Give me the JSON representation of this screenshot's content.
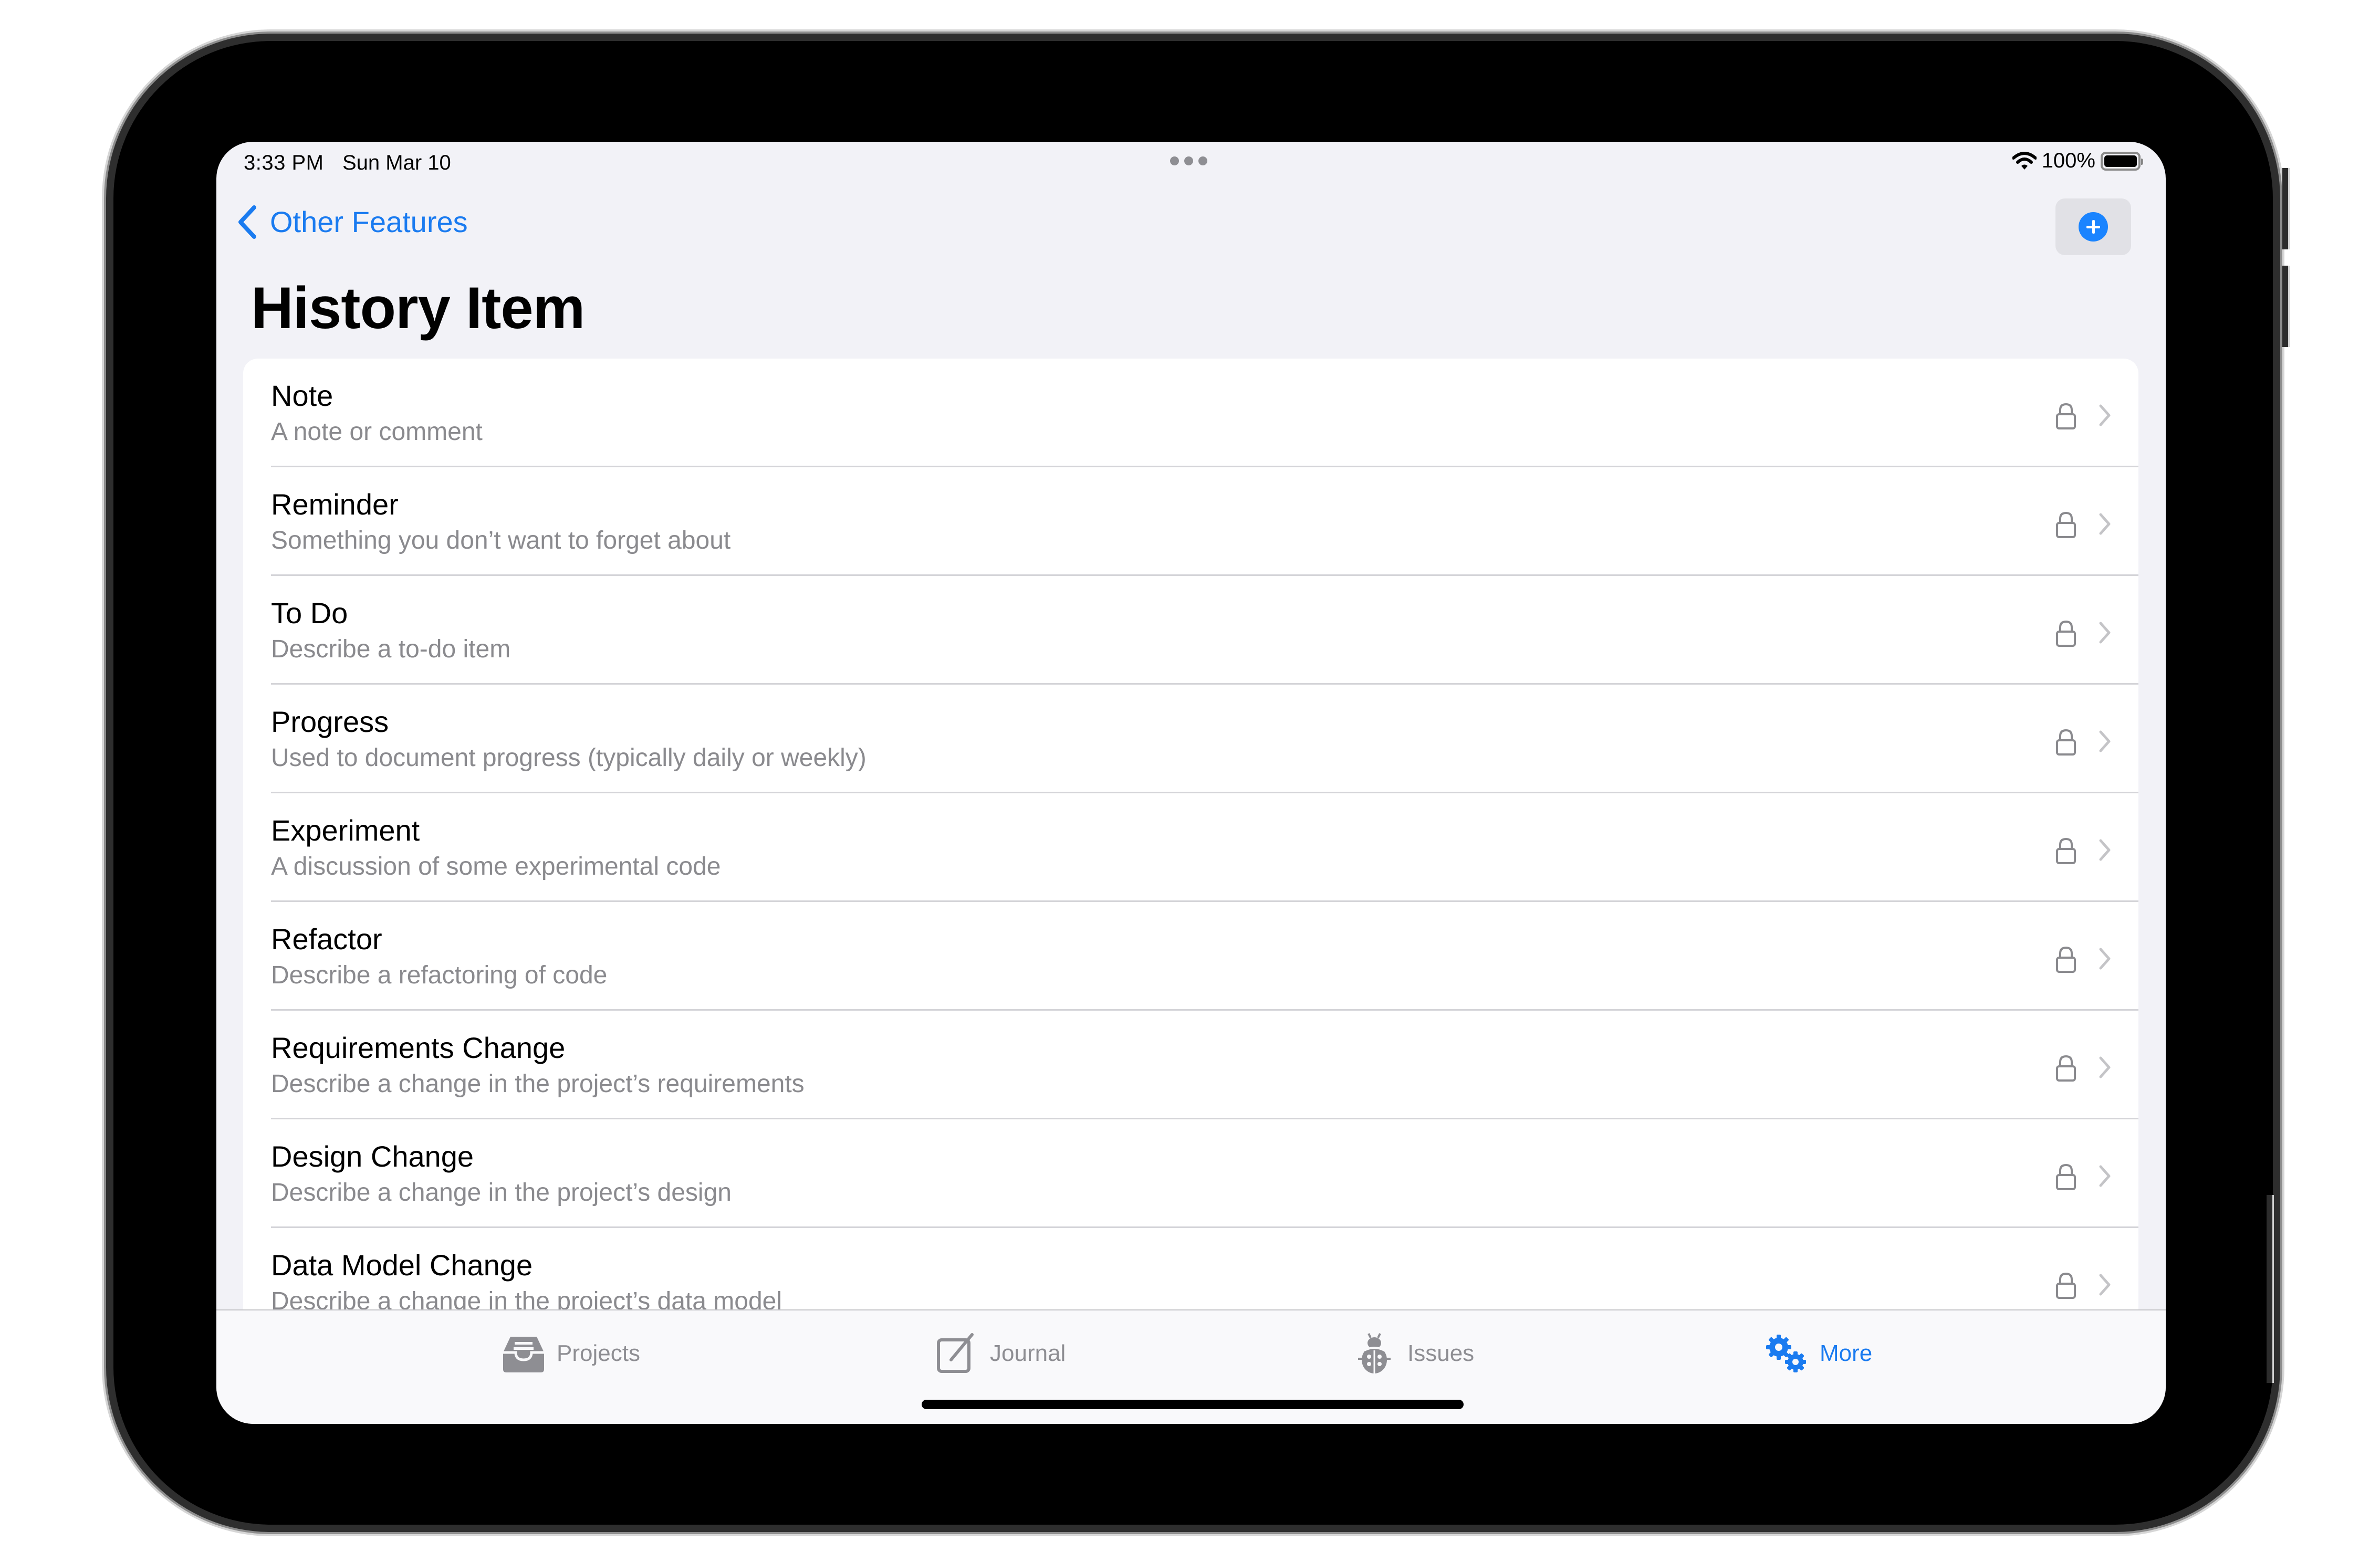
{
  "status_bar": {
    "time": "3:33 PM",
    "date": "Sun Mar 10",
    "battery_percent": "100%",
    "battery_level": 1.0,
    "wifi_icon": "wifi-icon",
    "multitasking_icon": "ellipsis-icon"
  },
  "nav": {
    "back_label": "Other Features",
    "back_icon": "chevron-left-icon",
    "add_icon": "plus-circle-icon"
  },
  "page": {
    "title": "History Item"
  },
  "items": [
    {
      "title": "Note",
      "subtitle": "A note or comment"
    },
    {
      "title": "Reminder",
      "subtitle": "Something you don’t want to forget about"
    },
    {
      "title": "To Do",
      "subtitle": "Describe a to-do item"
    },
    {
      "title": "Progress",
      "subtitle": "Used to document progress (typically daily or weekly)"
    },
    {
      "title": "Experiment",
      "subtitle": "A discussion of some experimental code"
    },
    {
      "title": "Refactor",
      "subtitle": "Describe a refactoring of code"
    },
    {
      "title": "Requirements Change",
      "subtitle": "Describe a change in the project’s requirements"
    },
    {
      "title": "Design Change",
      "subtitle": "Describe a change in the project’s design"
    },
    {
      "title": "Data Model Change",
      "subtitle": "Describe a change in the project’s data model"
    }
  ],
  "row_icons": {
    "lock": "lock-icon",
    "chevron": "chevron-right-icon"
  },
  "tabs": [
    {
      "label": "Projects",
      "icon": "tray-icon",
      "active": false
    },
    {
      "label": "Journal",
      "icon": "square-pencil-icon",
      "active": false
    },
    {
      "label": "Issues",
      "icon": "ladybug-icon",
      "active": false
    },
    {
      "label": "More",
      "icon": "gears-icon",
      "active": true
    }
  ],
  "colors": {
    "accent": "#1a7bf0",
    "background": "#f2f2f7",
    "secondary_text": "#8a8a8e",
    "inactive_tab": "#8e8e93"
  }
}
